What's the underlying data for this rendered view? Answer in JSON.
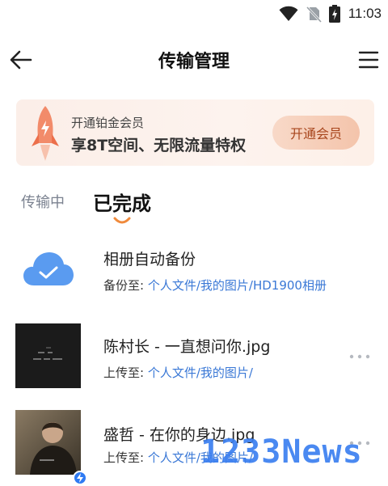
{
  "status_bar": {
    "time": "11:03"
  },
  "header": {
    "title": "传输管理"
  },
  "promo": {
    "subtitle": "开通铂金会员",
    "headline": "享8T空间、无限流量特权",
    "button_label": "开通会员"
  },
  "tabs": {
    "transferring": "传输中",
    "completed": "已完成"
  },
  "items": [
    {
      "title": "相册自动备份",
      "path_prefix": "备份至:",
      "path": "个人文件/我的图片/HD1900相册"
    },
    {
      "title": "陈村长 - 一直想问你.jpg",
      "path_prefix": "上传至:",
      "path": "个人文件/我的图片/"
    },
    {
      "title": "盛哲 - 在你的身边.jpg",
      "path_prefix": "上传至:",
      "path": "个人文件/我的图片/"
    }
  ],
  "watermark": "1233News",
  "colors": {
    "accent": "#3a78d6",
    "promo_button_text": "#a8461d",
    "tab_inactive": "#7b8290"
  }
}
